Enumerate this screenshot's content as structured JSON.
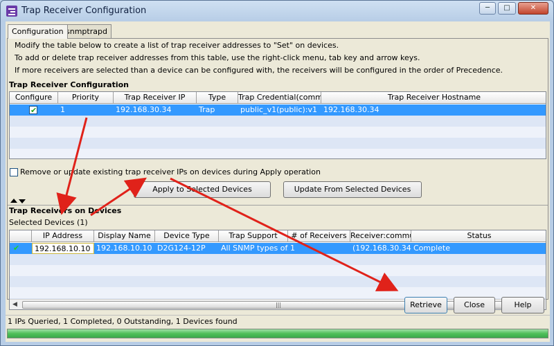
{
  "window": {
    "title": "Trap Receiver Configuration",
    "minimize": "─",
    "maximize": "□",
    "close": "✕"
  },
  "tabs": [
    {
      "label": "Configuration",
      "active": true
    },
    {
      "label": "snmptrapd",
      "active": false
    }
  ],
  "instructions": [
    "Modify the table below to create a list of trap receiver addresses to \"Set\" on devices.",
    "To add or delete trap receiver addresses from this table, use the right-click menu, tab key and arrow keys.",
    "If more receivers are selected than a device can be configured with, the receivers will be configured in the order of Precedence."
  ],
  "receiver_config": {
    "title": "Trap Receiver Configuration",
    "columns": [
      "Configure",
      "Priority",
      "Trap Receiver IP",
      "Type",
      "Trap Credential(comm...",
      "Trap Receiver Hostname"
    ],
    "rows": [
      {
        "configure": true,
        "priority": "1",
        "ip": "192.168.30.34",
        "type": "Trap",
        "credential": "public_v1(public):v1",
        "hostname": "192.168.30.34"
      }
    ]
  },
  "remove_update_option": {
    "label": "Remove or update existing trap receiver IPs on devices during Apply operation",
    "checked": false
  },
  "buttons": {
    "apply": "Apply to Selected Devices",
    "update": "Update From Selected Devices",
    "retrieve": "Retrieve",
    "close": "Close",
    "help": "Help"
  },
  "devices_section": {
    "title": "Trap Receivers on Devices",
    "selected_label": "Selected Devices (1)",
    "columns": [
      "",
      "IP Address",
      "Display Name",
      "Device Type",
      "Trap Support",
      "# of Receivers",
      "Receiver:commu...",
      "Status"
    ],
    "rows": [
      {
        "icon": "device-status-icon",
        "ip": "192.168.10.10",
        "display_name": "192.168.10.10",
        "device_type": "D2G124-12P",
        "trap_support": "All SNMP types of...",
        "receivers": "1",
        "receiver_community": "(192.168.30.34:...",
        "status": "Complete"
      }
    ],
    "scroll_grip": "|||"
  },
  "status": {
    "text": "1 IPs Queried, 1 Completed, 0 Outstanding, 1 Devices found",
    "progress": 1.0
  },
  "colors": {
    "selection": "#3399ff",
    "annotation_arrow": "#e0221a",
    "progress": "#4fbf59"
  }
}
